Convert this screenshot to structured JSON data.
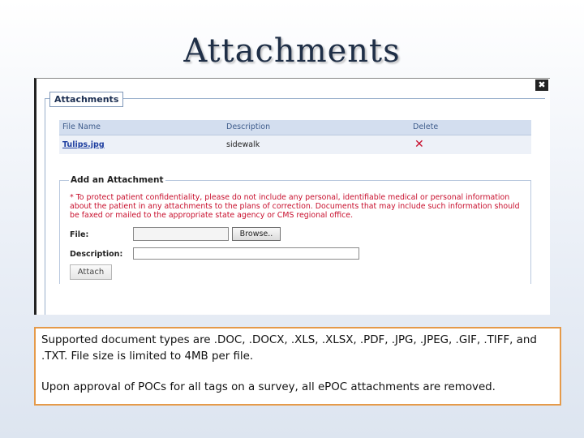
{
  "slide": {
    "title": "Attachments"
  },
  "dialog": {
    "close_glyph": "✖",
    "panel_title": "Attachments",
    "table": {
      "headers": [
        "File Name",
        "Description",
        "Delete"
      ],
      "rows": [
        {
          "file_name": "Tulips.jpg",
          "description": "sidewalk",
          "delete_glyph": "✕"
        }
      ]
    },
    "add_section": {
      "heading": "Add an Attachment",
      "warning": "* To protect patient confidentiality, please do not include any personal, identifiable medical or personal information about the patient in any attachments to the plans of correction. Documents that may include such information should be faxed or mailed to the appropriate state agency or CMS regional office.",
      "file_label": "File:",
      "file_value": "",
      "browse_label": "Browse..",
      "description_label": "Description:",
      "description_value": "",
      "attach_label": "Attach"
    }
  },
  "note": {
    "p1": "Supported document types are .DOC, .DOCX, .XLS, .XLSX, .PDF, .JPG, .JPEG, .GIF, .TIFF, and .TXT. File size is limited to 4MB per file.",
    "p2": "Upon approval of POCs for all tags on a survey, all ePOC attachments are removed."
  },
  "colors": {
    "warning_red": "#c8102e",
    "note_border": "#e59a4a",
    "header_blue": "#d3deef"
  },
  "icons": {
    "close": "close-icon",
    "delete": "delete-x-icon"
  }
}
